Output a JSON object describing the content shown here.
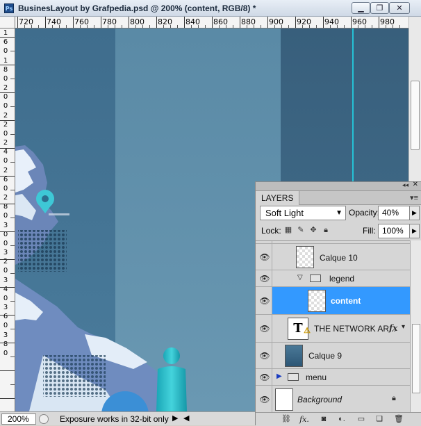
{
  "window": {
    "title": "BusinesLayout by Grafpedia.psd @ 200% (content, RGB/8) *",
    "logo_text": "Ps",
    "minimize": "▁",
    "restore": "❐",
    "close": "✕"
  },
  "ruler": {
    "h_labels": [
      "720",
      "740",
      "760",
      "780",
      "800",
      "820",
      "840",
      "860",
      "880",
      "900",
      "920",
      "940",
      "960",
      "980"
    ],
    "v_labels": [
      "1",
      "6",
      "0",
      "1",
      "8",
      "0",
      "2",
      "0",
      "0",
      "2",
      "2",
      "0",
      "2",
      "4",
      "0",
      "2",
      "6",
      "0",
      "2",
      "8",
      "0",
      "3",
      "0",
      "0",
      "3",
      "2",
      "0",
      "3",
      "4",
      "0",
      "3",
      "6",
      "0",
      "3",
      "8",
      "0"
    ]
  },
  "status": {
    "zoom": "200%",
    "message": "Exposure works in 32-bit only",
    "arrow": "▶",
    "scroll_left": "◀"
  },
  "layers": {
    "tab": "LAYERS",
    "blend_mode": "Soft Light",
    "opacity_label": "Opacity:",
    "opacity_value": "40%",
    "lock_label": "Lock:",
    "fill_label": "Fill:",
    "fill_value": "100%",
    "items": [
      {
        "name": "Calque 10"
      },
      {
        "name": "legend"
      },
      {
        "name": "content"
      },
      {
        "name": "THE NETWORK AR..."
      },
      {
        "name": "Calque 9"
      },
      {
        "name": "menu"
      },
      {
        "name": "Background"
      }
    ]
  },
  "colors": {
    "accent": "#3399ff",
    "canvas_dark": "#3e6c8c",
    "canvas_light": "#5d8ba6",
    "guide": "#25c2d6"
  }
}
